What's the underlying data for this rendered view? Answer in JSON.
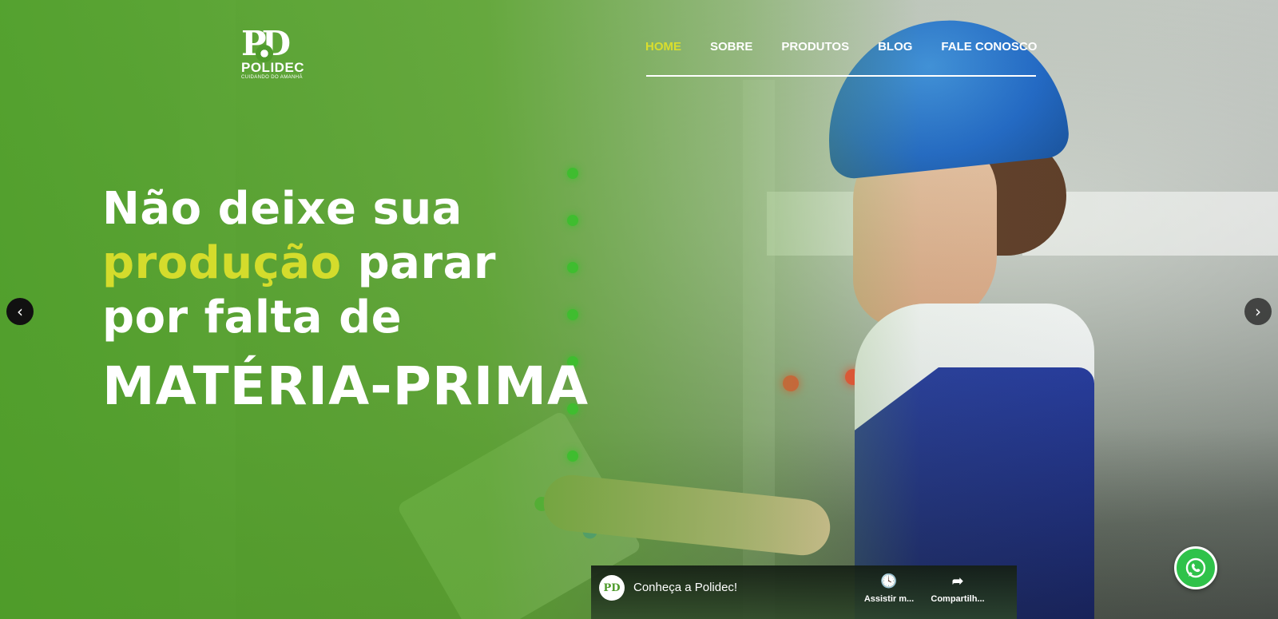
{
  "brand": {
    "mark": "PD",
    "name": "POLIDEC",
    "tagline": "CUIDANDO DO AMANHÃ"
  },
  "nav": {
    "items": [
      {
        "label": "HOME",
        "active": true
      },
      {
        "label": "SOBRE"
      },
      {
        "label": "PRODUTOS"
      },
      {
        "label": "BLOG"
      },
      {
        "label": "FALE CONOSCO"
      }
    ]
  },
  "hero": {
    "line1": "Não deixe sua",
    "line2_accent": "produção",
    "line2_rest": " parar",
    "line3": "por falta de",
    "line4": "MATÉRIA-PRIMA"
  },
  "carousel": {
    "prev_icon": "chevron-left-icon",
    "next_icon": "chevron-right-icon"
  },
  "video": {
    "channel_initials": "PD",
    "title": "Conheça a Polidec!",
    "watch_label": "Assistir m...",
    "share_label": "Compartilh..."
  },
  "colors": {
    "accent": "#d4dc2c",
    "green_overlay": "#4fa028",
    "whatsapp": "#2fc24a"
  }
}
